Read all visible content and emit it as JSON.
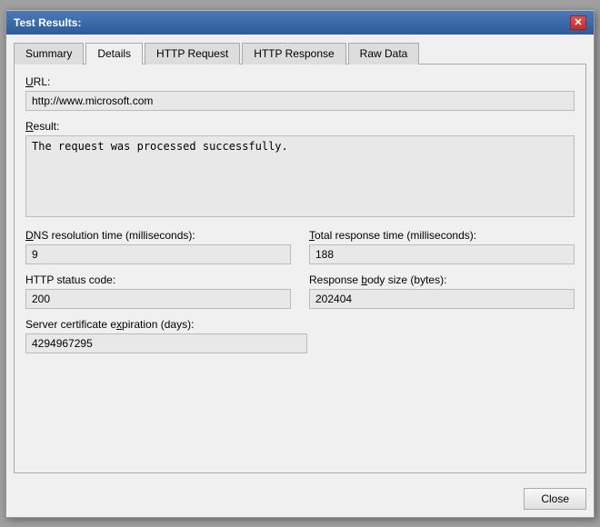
{
  "dialog": {
    "title": "Test Results:",
    "close_x": "✕"
  },
  "tabs": [
    {
      "id": "summary",
      "label": "Summary",
      "active": false
    },
    {
      "id": "details",
      "label": "Details",
      "active": true
    },
    {
      "id": "http-request",
      "label": "HTTP Request",
      "active": false
    },
    {
      "id": "http-response",
      "label": "HTTP Response",
      "active": false
    },
    {
      "id": "raw-data",
      "label": "Raw Data",
      "active": false
    }
  ],
  "fields": {
    "url_label": "URL:",
    "url_value": "http://www.microsoft.com",
    "result_label": "Result:",
    "result_value": "The request was processed successfully.",
    "dns_label": "DNS resolution time (milliseconds):",
    "dns_value": "9",
    "total_response_label": "Total response time (milliseconds):",
    "total_response_value": "188",
    "http_status_label": "HTTP status code:",
    "http_status_value": "200",
    "body_size_label": "Response body size (bytes):",
    "body_size_value": "202404",
    "cert_expiry_label": "Server certificate expiration (days):",
    "cert_expiry_value": "4294967295"
  },
  "footer": {
    "close_label": "Close"
  }
}
